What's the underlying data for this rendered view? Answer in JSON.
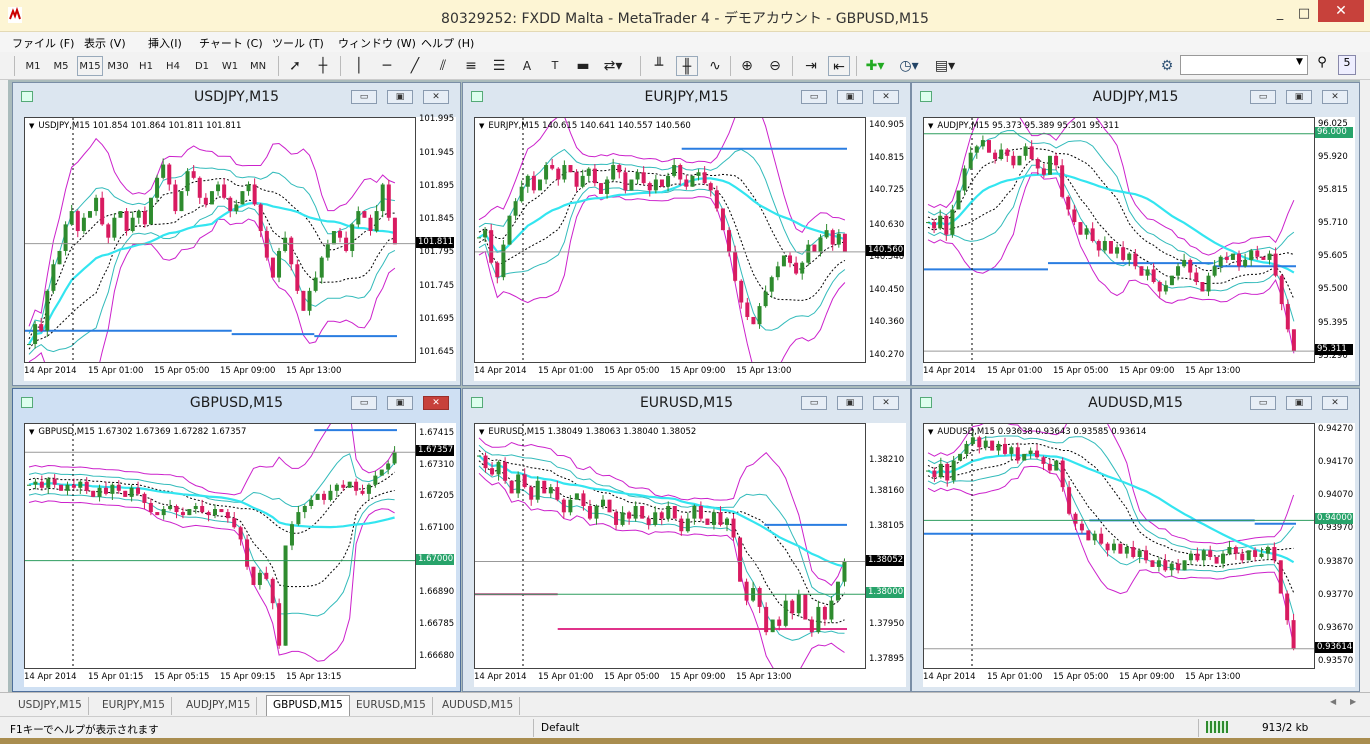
{
  "app": {
    "title": "80329252: FXDD Malta - MetaTrader 4 - デモアカウント - GBPUSD,M15",
    "minimize": "_",
    "maximize": "□",
    "close": "✕"
  },
  "menu": [
    "ファイル (F)",
    "表示 (V)",
    "挿入(I)",
    "チャート (C)",
    "ツール (T)",
    "ウィンドウ (W)",
    "ヘルプ (H)"
  ],
  "toolbar": {
    "timeframes": [
      "M1",
      "M5",
      "M15",
      "M30",
      "H1",
      "H4",
      "D1",
      "W1",
      "MN"
    ],
    "active_timeframe": "M15",
    "icons": [
      "cursor-icon",
      "crosshair-icon",
      "vertical-line-icon",
      "horizontal-line-icon",
      "trendline-icon",
      "equidistant-channel-icon",
      "fibonacci-icon",
      "text-icon",
      "text-label-icon",
      "arrow-sign-icon",
      "bar-chart-icon",
      "candlestick-icon",
      "line-chart-icon",
      "zoom-in-icon",
      "zoom-out-icon",
      "autoscroll-icon",
      "chart-shift-icon",
      "indicators-icon",
      "periods-icon",
      "templates-icon"
    ],
    "search_value": "",
    "settings_icon": "gear-icon",
    "search_icon": "search-icon",
    "help_icon": "help-icon",
    "help_label": "5"
  },
  "colors": {
    "bull": "#2e8b2e",
    "bear": "#d81b60",
    "bands_outer": "#cc22cc",
    "bands_inner": "#33bbbb",
    "ma_cyan": "#33e5f0",
    "level_blue": "#2a7de1",
    "level_green": "#2e9d5f",
    "level_magenta": "#e0338a",
    "price_tag": "#000000",
    "level_tag_green": "#27a36a"
  },
  "charts": [
    {
      "id": "usdjpy",
      "name": "USDJPY,M15",
      "ohlc": "USDJPY,M15  101.854 101.864 101.811 101.811",
      "price_ticks": [
        "101.995",
        "101.945",
        "101.895",
        "101.845",
        "101.795",
        "101.745",
        "101.695",
        "101.645"
      ],
      "ymin": 101.63,
      "ymax": 102.0,
      "bid": 101.811,
      "bid_label": "101.811",
      "level_tag": null,
      "time_ticks": [
        "14 Apr 2014",
        "15 Apr 01:00",
        "15 Apr 05:00",
        "15 Apr 09:00",
        "15 Apr 13:00"
      ],
      "series": [
        101.66,
        101.69,
        101.68,
        101.74,
        101.78,
        101.8,
        101.84,
        101.86,
        101.83,
        101.85,
        101.86,
        101.88,
        101.84,
        101.82,
        101.85,
        101.86,
        101.83,
        101.85,
        101.86,
        101.84,
        101.88,
        101.91,
        101.93,
        101.9,
        101.86,
        101.89,
        101.92,
        101.91,
        101.88,
        101.87,
        101.89,
        101.9,
        101.88,
        101.86,
        101.87,
        101.89,
        101.9,
        101.87,
        101.83,
        101.79,
        101.76,
        101.8,
        101.82,
        101.78,
        101.74,
        101.71,
        101.74,
        101.76,
        101.79,
        101.81,
        101.83,
        101.82,
        101.8,
        101.84,
        101.86,
        101.85,
        101.83,
        101.86,
        101.9,
        101.85,
        101.81
      ],
      "lines": [
        {
          "kind": "level",
          "color": "level_blue",
          "values": [
            101.68,
            101.68,
            101.68,
            101.68,
            101.68,
            101.675,
            101.675,
            101.672,
            101.672
          ]
        }
      ]
    },
    {
      "id": "eurjpy",
      "name": "EURJPY,M15",
      "ohlc": "EURJPY,M15  140.615 140.641 140.557 140.560",
      "price_ticks": [
        "140.905",
        "140.815",
        "140.725",
        "140.630",
        "140.540",
        "140.450",
        "140.360",
        "140.270"
      ],
      "ymin": 140.25,
      "ymax": 140.93,
      "bid": 140.56,
      "bid_label": "140.560",
      "level_tag": null,
      "time_ticks": [
        "14 Apr 2014",
        "15 Apr 01:00",
        "15 Apr 05:00",
        "15 Apr 09:00",
        "15 Apr 13:00"
      ],
      "series": [
        140.6,
        140.62,
        140.53,
        140.49,
        140.58,
        140.66,
        140.7,
        140.74,
        140.77,
        140.73,
        140.76,
        140.8,
        140.79,
        140.76,
        140.8,
        140.78,
        140.74,
        140.77,
        140.79,
        140.75,
        140.72,
        140.76,
        140.8,
        140.78,
        140.73,
        140.76,
        140.78,
        140.75,
        140.73,
        140.76,
        140.74,
        140.77,
        140.8,
        140.76,
        140.74,
        140.77,
        140.78,
        140.75,
        140.73,
        140.68,
        140.62,
        140.56,
        140.48,
        140.42,
        140.38,
        140.36,
        140.41,
        140.45,
        140.49,
        140.52,
        140.55,
        140.53,
        140.5,
        140.53,
        140.58,
        140.56,
        140.6,
        140.62,
        140.58,
        140.61,
        140.56
      ],
      "lines": [
        {
          "kind": "level",
          "color": "level_blue",
          "values": [
            null,
            null,
            null,
            null,
            null,
            140.845,
            140.845,
            140.845,
            140.845
          ]
        }
      ]
    },
    {
      "id": "audjpy",
      "name": "AUDJPY,M15",
      "ohlc": "AUDJPY,M15  95.373 95.389 95.301 95.311",
      "price_ticks": [
        "96.025",
        "95.920",
        "95.815",
        "95.710",
        "95.605",
        "95.500",
        "95.395",
        "95.290"
      ],
      "ymin": 95.27,
      "ymax": 96.05,
      "bid": 95.311,
      "bid_label": "95.311",
      "level_tag": {
        "value": 96.0,
        "label": "96.000"
      },
      "time_ticks": [
        "14 Apr 2014",
        "15 Apr 01:00",
        "15 Apr 05:00",
        "15 Apr 09:00",
        "15 Apr 13:00"
      ],
      "series": [
        95.72,
        95.7,
        95.74,
        95.68,
        95.76,
        95.82,
        95.89,
        95.94,
        95.96,
        95.98,
        95.94,
        95.92,
        95.95,
        95.93,
        95.9,
        95.93,
        95.96,
        95.92,
        95.89,
        95.87,
        95.93,
        95.9,
        95.8,
        95.76,
        95.72,
        95.68,
        95.7,
        95.66,
        95.63,
        95.66,
        95.62,
        95.64,
        95.6,
        95.62,
        95.58,
        95.55,
        95.57,
        95.53,
        95.5,
        95.52,
        95.55,
        95.58,
        95.6,
        95.56,
        95.53,
        95.5,
        95.55,
        95.58,
        95.61,
        95.6,
        95.62,
        95.58,
        95.6,
        95.63,
        95.61,
        95.6,
        95.62,
        95.55,
        95.46,
        95.38,
        95.31
      ],
      "lines": [
        {
          "kind": "level",
          "color": "level_blue",
          "values": [
            95.57,
            95.57,
            95.57,
            95.59,
            95.59,
            95.59,
            95.59,
            95.58,
            95.58
          ]
        }
      ]
    },
    {
      "id": "gbpusd",
      "name": "GBPUSD,M15",
      "ohlc": "GBPUSD,M15  1.67302 1.67369 1.67282 1.67357",
      "price_ticks": [
        "1.67415",
        "1.67310",
        "1.67205",
        "1.67100",
        "1.66995",
        "1.66890",
        "1.66785",
        "1.66680"
      ],
      "ymin": 1.6664,
      "ymax": 1.6745,
      "bid": 1.67357,
      "bid_label": "1.67357",
      "level_tag": {
        "value": 1.67,
        "label": "1.67000"
      },
      "time_ticks": [
        "14 Apr 2014",
        "15 Apr 01:15",
        "15 Apr 05:15",
        "15 Apr 09:15",
        "15 Apr 13:15"
      ],
      "series": [
        1.6725,
        1.6726,
        1.6724,
        1.6727,
        1.6725,
        1.6723,
        1.6725,
        1.6724,
        1.6726,
        1.6723,
        1.6721,
        1.6724,
        1.6722,
        1.6725,
        1.6723,
        1.6721,
        1.6724,
        1.6722,
        1.6719,
        1.6716,
        1.6715,
        1.6717,
        1.6718,
        1.6716,
        1.6715,
        1.6717,
        1.6718,
        1.6716,
        1.6715,
        1.6717,
        1.6716,
        1.6714,
        1.6711,
        1.6707,
        1.6698,
        1.6692,
        1.6696,
        1.6694,
        1.6686,
        1.6672,
        1.6705,
        1.6712,
        1.6716,
        1.6718,
        1.672,
        1.6722,
        1.672,
        1.6723,
        1.6725,
        1.6724,
        1.6726,
        1.6723,
        1.6722,
        1.6725,
        1.6728,
        1.673,
        1.6732,
        1.67357
      ],
      "lines": [
        {
          "kind": "level",
          "color": "level_blue",
          "values": [
            null,
            null,
            null,
            null,
            null,
            null,
            null,
            1.6743,
            1.6743
          ]
        }
      ]
    },
    {
      "id": "eurusd",
      "name": "EURUSD,M15",
      "ohlc": "EURUSD,M15  1.38049 1.38063 1.38040 1.38052",
      "price_ticks": [
        "1.38210",
        "1.38160",
        "1.38105",
        "1.38050",
        "1.38000",
        "1.37950",
        "1.37895"
      ],
      "ymin": 1.3788,
      "ymax": 1.3827,
      "bid": 1.38052,
      "bid_label": "1.38052",
      "level_tag": {
        "value": 1.38,
        "label": "1.38000"
      },
      "time_ticks": [
        "14 Apr 2014",
        "15 Apr 01:00",
        "15 Apr 05:00",
        "15 Apr 09:00",
        "15 Apr 13:00"
      ],
      "series": [
        1.3822,
        1.382,
        1.3819,
        1.3821,
        1.3818,
        1.3816,
        1.3819,
        1.3817,
        1.3815,
        1.3818,
        1.3816,
        1.3817,
        1.3815,
        1.3813,
        1.3815,
        1.3816,
        1.3814,
        1.3812,
        1.3814,
        1.3815,
        1.3813,
        1.3811,
        1.3813,
        1.3812,
        1.3814,
        1.3812,
        1.3811,
        1.3813,
        1.3812,
        1.3814,
        1.3812,
        1.381,
        1.3812,
        1.3814,
        1.3812,
        1.3811,
        1.3813,
        1.3811,
        1.3812,
        1.3809,
        1.3802,
        1.3799,
        1.3801,
        1.3798,
        1.3794,
        1.3796,
        1.3795,
        1.3799,
        1.3797,
        1.38,
        1.3796,
        1.3794,
        1.3798,
        1.3796,
        1.3799,
        1.3802,
        1.38052
      ],
      "lines": [
        {
          "kind": "level",
          "color": "level_magenta",
          "values": [
            1.38,
            1.38,
            1.37945,
            1.37945,
            1.37945,
            1.37945,
            1.37945,
            1.37945,
            1.37945
          ]
        },
        {
          "kind": "level",
          "color": "level_blue",
          "values": [
            null,
            null,
            null,
            null,
            null,
            null,
            null,
            1.3811,
            1.3811
          ]
        }
      ]
    },
    {
      "id": "audusd",
      "name": "AUDUSD,M15",
      "ohlc": "AUDUSD,M15  0.93638 0.93643 0.93585 0.93614",
      "price_ticks": [
        "0.94270",
        "0.94170",
        "0.94070",
        "0.93970",
        "0.93870",
        "0.93770",
        "0.93670",
        "0.93570"
      ],
      "ymin": 0.9355,
      "ymax": 0.9429,
      "bid": 0.93614,
      "bid_label": "0.93614",
      "level_tag": {
        "value": 0.94,
        "label": "0.94000"
      },
      "time_ticks": [
        "14 Apr 2014",
        "15 Apr 01:00",
        "15 Apr 05:00",
        "15 Apr 09:00",
        "15 Apr 13:00"
      ],
      "series": [
        0.9415,
        0.9413,
        0.9417,
        0.9412,
        0.9418,
        0.942,
        0.9423,
        0.9425,
        0.9422,
        0.9424,
        0.9421,
        0.9423,
        0.942,
        0.9422,
        0.9418,
        0.942,
        0.9421,
        0.9419,
        0.9417,
        0.9415,
        0.9418,
        0.941,
        0.9402,
        0.9399,
        0.9397,
        0.9394,
        0.9396,
        0.9393,
        0.9391,
        0.9393,
        0.939,
        0.9392,
        0.9389,
        0.9391,
        0.9388,
        0.9386,
        0.9388,
        0.9385,
        0.9387,
        0.9385,
        0.9388,
        0.939,
        0.9388,
        0.9391,
        0.9389,
        0.9387,
        0.939,
        0.9392,
        0.939,
        0.9388,
        0.9391,
        0.9389,
        0.939,
        0.9392,
        0.9388,
        0.9378,
        0.937,
        0.93614
      ],
      "lines": [
        {
          "kind": "level",
          "color": "level_blue",
          "values": [
            0.9396,
            0.9396,
            0.9396,
            0.9396,
            0.94,
            0.94,
            0.94,
            0.94,
            0.9399
          ]
        }
      ]
    }
  ],
  "tabs": [
    "USDJPY,M15",
    "EURJPY,M15",
    "AUDJPY,M15",
    "GBPUSD,M15",
    "EURUSD,M15",
    "AUDUSD,M15"
  ],
  "active_tab": "GBPUSD,M15",
  "status": {
    "help": "F1キーでヘルプが表示されます",
    "profile": "Default",
    "traffic": "913/2 kb"
  }
}
